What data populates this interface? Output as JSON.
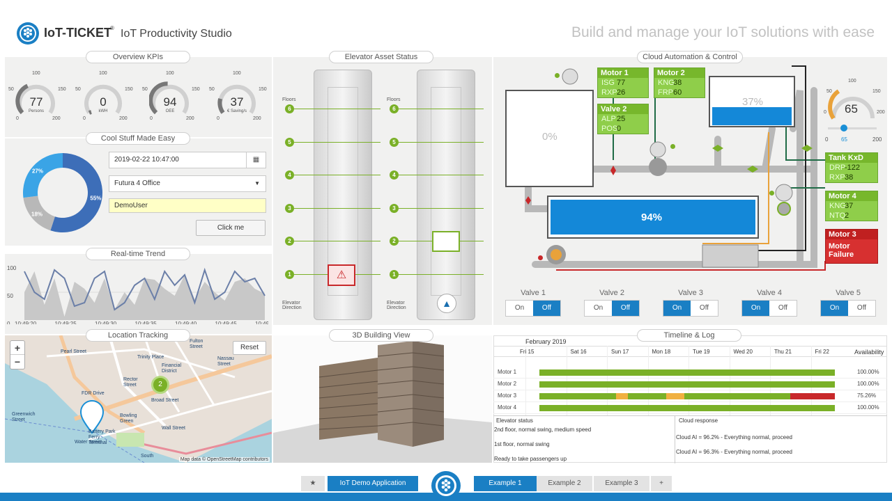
{
  "header": {
    "brand": "IoT-TICKET",
    "trademark": "®",
    "app_title": "IoT Productivity Studio",
    "tagline": "Build and manage your IoT solutions with ease"
  },
  "kpis": {
    "title": "Overview KPIs",
    "gauges": [
      {
        "value": "77",
        "unit": "Persons",
        "min": "0",
        "mid": "100",
        "max": "200",
        "left": "50",
        "right": "150",
        "fraction": 0.385
      },
      {
        "value": "0",
        "unit": "kWH",
        "min": "0",
        "mid": "100",
        "max": "200",
        "left": "50",
        "right": "150",
        "fraction": 0.0
      },
      {
        "value": "94",
        "unit": "OEE",
        "min": "0",
        "mid": "100",
        "max": "200",
        "left": "50",
        "right": "150",
        "fraction": 0.47
      },
      {
        "value": "37",
        "unit": "€ Saving/s",
        "min": "0",
        "mid": "100",
        "max": "200",
        "left": "50",
        "right": "150",
        "fraction": 0.185
      }
    ]
  },
  "cool": {
    "title": "Cool Stuff Made Easy",
    "date": "2019-02-22 10:47:00",
    "select": "Futura 4 Office",
    "user": "DemoUser",
    "button": "Click me",
    "donut": [
      {
        "label": "55%",
        "value": 55,
        "color": "#3d6eb8"
      },
      {
        "label": "18%",
        "value": 18,
        "color": "#b8b8b8"
      },
      {
        "label": "27%",
        "value": 27,
        "color": "#3aa4e6"
      }
    ]
  },
  "trend": {
    "title": "Real-time Trend",
    "y_ticks": [
      "100",
      "50",
      "0"
    ],
    "x_ticks": [
      "10:49:20",
      "10:49:25",
      "10:49:30",
      "10:49:35",
      "10:49:40",
      "10:49:45",
      "10:49:50"
    ]
  },
  "map": {
    "title": "Location Tracking",
    "zoom_in": "+",
    "zoom_out": "−",
    "reset": "Reset",
    "cluster": "2",
    "attribution": "Map data © OpenStreetMap contributors",
    "labels": [
      "Fulton Street",
      "Rector Street",
      "Bowling Green",
      "Wall Street",
      "Financial District",
      "Water Street",
      "FDR Drive",
      "Battery Park Ferry Terminal",
      "South",
      "Broad Street",
      "Pearl Street",
      "Trinity Place",
      "Greenwich Street",
      "Nassau Street"
    ]
  },
  "elevator": {
    "title": "Elevator Asset Status",
    "floors_label": "Floors",
    "direction_label": "Elevator Direction",
    "floors": [
      "6",
      "5",
      "4",
      "3",
      "2",
      "1"
    ]
  },
  "building": {
    "title": "3D Building View"
  },
  "automation": {
    "title": "Cloud Automation & Control",
    "tank1": "0%",
    "tank2": "37%",
    "tank3": "94%",
    "motor1": {
      "name": "Motor 1",
      "rows": [
        [
          "ISG",
          "77"
        ],
        [
          "RXP",
          "26"
        ]
      ]
    },
    "motor2": {
      "name": "Motor 2",
      "rows": [
        [
          "KNG",
          "38"
        ],
        [
          "FRP",
          "60"
        ]
      ]
    },
    "valve2": {
      "name": "Valve 2",
      "rows": [
        [
          "ALP",
          "25"
        ],
        [
          "POS",
          "0"
        ]
      ]
    },
    "tank": {
      "name": "Tank KxD",
      "rows": [
        [
          "DRP",
          "-122"
        ],
        [
          "RXP",
          "38"
        ]
      ]
    },
    "motor4": {
      "name": "Motor 4",
      "rows": [
        [
          "KNG",
          "37"
        ],
        [
          "NTQ",
          "2"
        ]
      ]
    },
    "motor3": {
      "name": "Motor 3",
      "status": "Motor Failure"
    },
    "gauge": {
      "value": "65",
      "ticks": [
        "0",
        "50",
        "100",
        "150",
        "200"
      ],
      "slider_min": "0",
      "slider_val": "65",
      "slider_max": "200",
      "fraction": 0.325
    },
    "valves": [
      {
        "name": "Valve 1",
        "on": "On",
        "off": "Off",
        "state": "off"
      },
      {
        "name": "Valve 2",
        "on": "On",
        "off": "Off",
        "state": "off"
      },
      {
        "name": "Valve 3",
        "on": "On",
        "off": "Off",
        "state": "on"
      },
      {
        "name": "Valve 4",
        "on": "On",
        "off": "Off",
        "state": "on"
      },
      {
        "name": "Valve 5",
        "on": "On",
        "off": "Off",
        "state": "on"
      }
    ]
  },
  "timeline": {
    "title": "Timeline & Log",
    "month": "February 2019",
    "days": [
      "Fri 15",
      "Sat 16",
      "Sun 17",
      "Mon 18",
      "Tue 19",
      "Wed 20",
      "Thu 21",
      "Fri 22"
    ],
    "avail_header": "Availability",
    "rows": [
      {
        "name": "Motor 1",
        "avail": "100.00%"
      },
      {
        "name": "Motor 2",
        "avail": "100.00%"
      },
      {
        "name": "Motor 3",
        "avail": "75.26%"
      },
      {
        "name": "Motor 4",
        "avail": "100.00%"
      }
    ],
    "log_headers": [
      "Elevator status",
      "Cloud response"
    ],
    "log": [
      {
        "status": "2nd floor, normal swing, medium speed",
        "response": ""
      },
      {
        "status": "",
        "response": "Cloud AI = 96.2% - Everything normal, proceed"
      },
      {
        "status": "1st floor, normal swing",
        "response": ""
      },
      {
        "status": "",
        "response": "Cloud AI = 96.3% - Everything normal, proceed"
      },
      {
        "status": "Ready to take passengers up",
        "response": ""
      }
    ]
  },
  "tabs": {
    "star": "★",
    "items": [
      "IoT Demo Application",
      "Example 1",
      "Example 2",
      "Example 3"
    ],
    "add": "+"
  },
  "colors": {
    "accent": "#1a8fd6",
    "green": "#7ab027",
    "red": "#c8282a",
    "blue_fill": "#1488d8"
  }
}
